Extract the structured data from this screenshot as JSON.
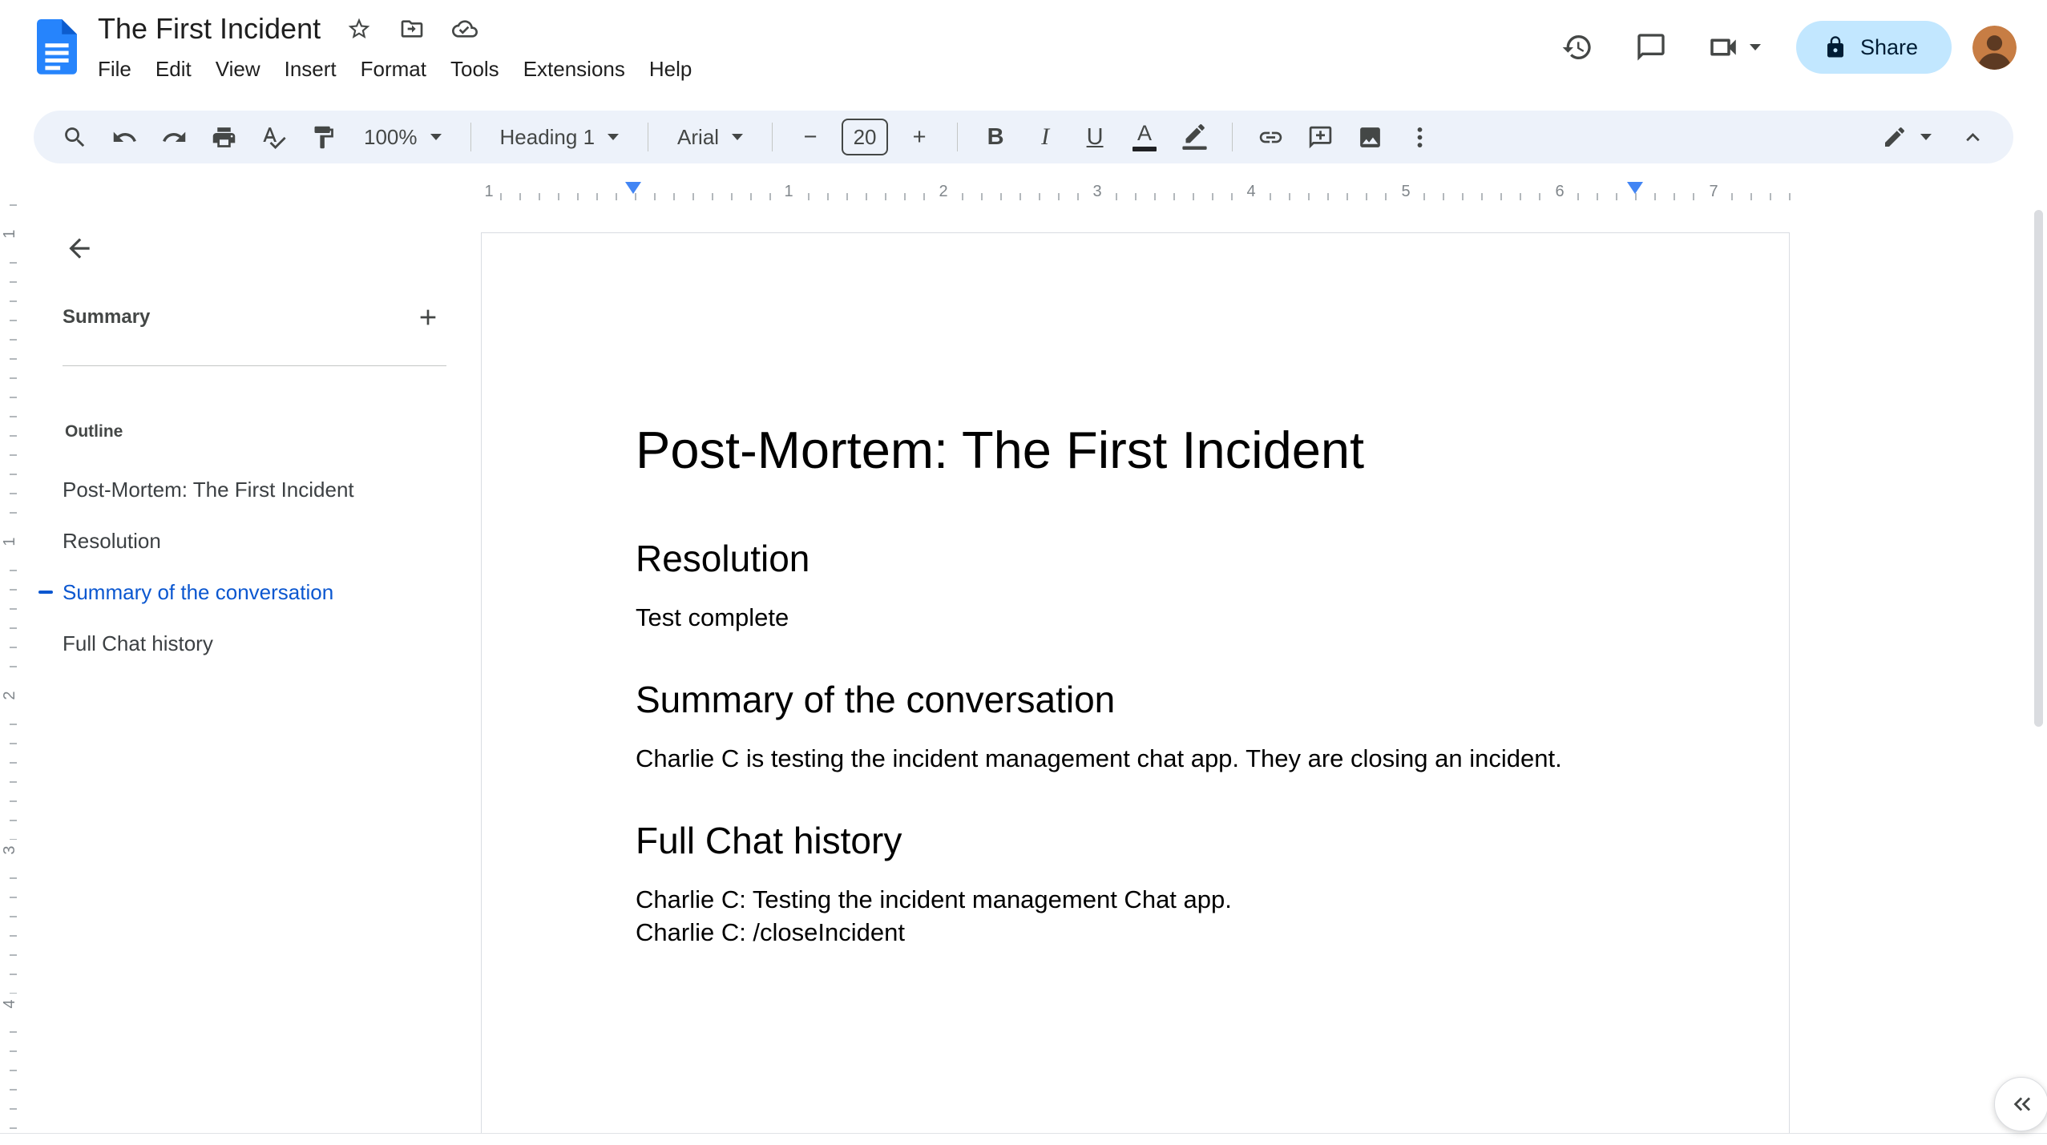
{
  "header": {
    "title": "The First Incident",
    "menu": [
      "File",
      "Edit",
      "View",
      "Insert",
      "Format",
      "Tools",
      "Extensions",
      "Help"
    ],
    "share_label": "Share"
  },
  "toolbar": {
    "zoom_value": "100%",
    "styles_value": "Heading 1",
    "font_value": "Arial",
    "font_size_value": "20"
  },
  "icons": {
    "bold": "B",
    "italic": "I",
    "underline": "U",
    "text_color": "A",
    "minus": "−",
    "plus": "+"
  },
  "ruler": {
    "h_numbers": [
      "1",
      "1",
      "2",
      "3",
      "4",
      "5",
      "6",
      "7"
    ],
    "v_numbers": [
      "1",
      "1",
      "2",
      "3",
      "4"
    ]
  },
  "sidebar": {
    "summary_label": "Summary",
    "outline_label": "Outline",
    "active_index": 2,
    "items": [
      {
        "label": "Post-Mortem: The First Incident"
      },
      {
        "label": "Resolution"
      },
      {
        "label": "Summary of the conversation"
      },
      {
        "label": "Full Chat history"
      }
    ]
  },
  "document": {
    "title": "Post-Mortem: The First Incident",
    "sections": [
      {
        "heading": "Resolution",
        "paragraphs": [
          "Test complete"
        ]
      },
      {
        "heading": "Summary of the conversation",
        "paragraphs": [
          "Charlie C is testing the incident management chat app. They are closing an incident."
        ]
      },
      {
        "heading": "Full Chat history",
        "paragraphs": [
          "Charlie C: Testing the incident management Chat app.",
          "Charlie C: /closeIncident"
        ]
      }
    ]
  },
  "colors": {
    "accent_blue": "#0b57d0",
    "share_bg": "#c2e7ff",
    "share_text": "#001d35",
    "toolbar_bg": "#edf2fa",
    "icon_gray": "#444746",
    "marker_blue": "#4285f4"
  }
}
